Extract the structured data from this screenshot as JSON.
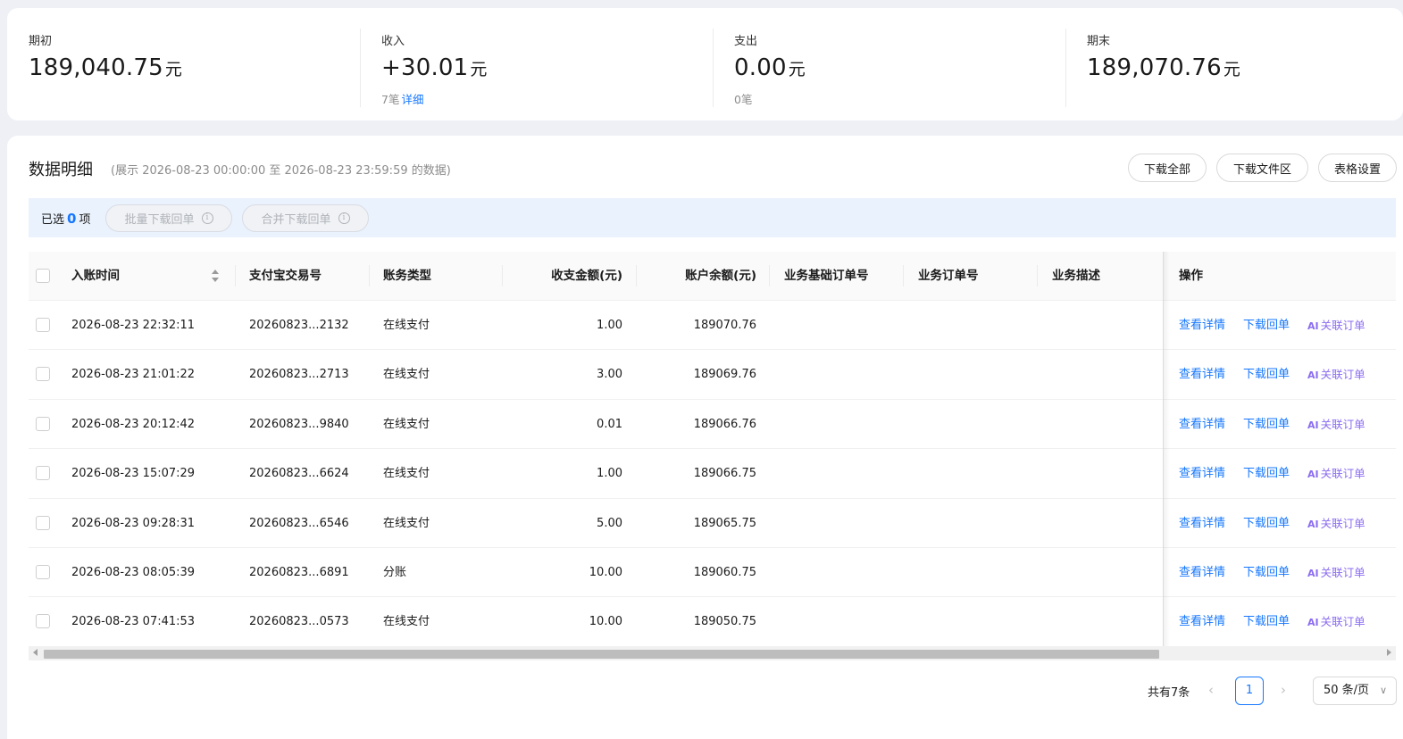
{
  "summary": [
    {
      "label": "期初",
      "value": "189,040.75",
      "unit": "元",
      "count": "",
      "link": ""
    },
    {
      "label": "收入",
      "value": "+30.01",
      "unit": "元",
      "count": "7笔",
      "link": "详细"
    },
    {
      "label": "支出",
      "value": "0.00",
      "unit": "元",
      "count": "0笔",
      "link": ""
    },
    {
      "label": "期末",
      "value": "189,070.76",
      "unit": "元",
      "count": "",
      "link": ""
    }
  ],
  "detail": {
    "title": "数据明细",
    "range": "(展示 2026-08-23 00:00:00 至 2026-08-23 23:59:59 的数据)",
    "buttons": {
      "download_all": "下载全部",
      "download_folder": "下载文件区",
      "table_settings": "表格设置"
    }
  },
  "selection": {
    "prefix": "已选",
    "count": "0",
    "suffix": "项",
    "batch_download": "批量下载回单",
    "merge_download": "合并下载回单",
    "info_glyph": "i"
  },
  "table": {
    "headers": {
      "time": "入账时间",
      "trade_no": "支付宝交易号",
      "type": "账务类型",
      "amount": "收支金额(元)",
      "balance": "账户余额(元)",
      "base_order": "业务基础订单号",
      "order": "业务订单号",
      "desc": "业务描述",
      "ops": "操作"
    },
    "op_labels": {
      "view": "查看详情",
      "download": "下载回单",
      "ai_glyph": "AI",
      "link_order": "关联订单"
    },
    "rows": [
      {
        "time": "2026-08-23 22:32:11",
        "trade_no": "20260823...2132",
        "type": "在线支付",
        "amount": "1.00",
        "balance": "189070.76"
      },
      {
        "time": "2026-08-23 21:01:22",
        "trade_no": "20260823...2713",
        "type": "在线支付",
        "amount": "3.00",
        "balance": "189069.76"
      },
      {
        "time": "2026-08-23 20:12:42",
        "trade_no": "20260823...9840",
        "type": "在线支付",
        "amount": "0.01",
        "balance": "189066.76"
      },
      {
        "time": "2026-08-23 15:07:29",
        "trade_no": "20260823...6624",
        "type": "在线支付",
        "amount": "1.00",
        "balance": "189066.75"
      },
      {
        "time": "2026-08-23 09:28:31",
        "trade_no": "20260823...6546",
        "type": "在线支付",
        "amount": "5.00",
        "balance": "189065.75"
      },
      {
        "time": "2026-08-23 08:05:39",
        "trade_no": "20260823...6891",
        "type": "分账",
        "amount": "10.00",
        "balance": "189060.75"
      },
      {
        "time": "2026-08-23 07:41:53",
        "trade_no": "20260823...0573",
        "type": "在线支付",
        "amount": "10.00",
        "balance": "189050.75"
      }
    ]
  },
  "pagination": {
    "total": "共有7条",
    "current_page": "1",
    "page_size": "50 条/页",
    "prev_glyph": "‹",
    "next_glyph": "›",
    "dropdown_glyph": "∨"
  },
  "colors": {
    "accent": "#1677ff",
    "ai": "#8b6cf0",
    "selection_bar": "#eaf2fd"
  }
}
